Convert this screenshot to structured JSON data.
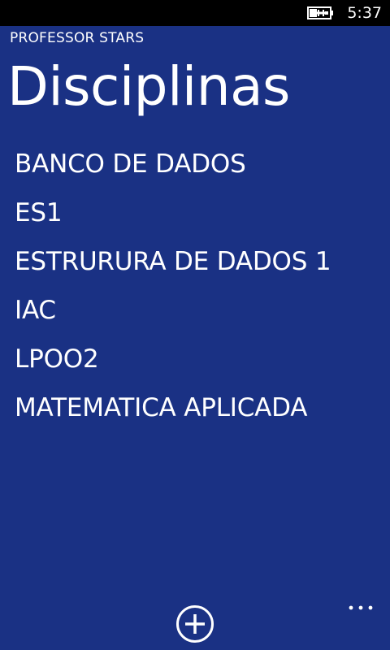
{
  "status_bar": {
    "time": "5:37",
    "battery_icon": "battery-charging-icon"
  },
  "header": {
    "app_title": "PROFESSOR STARS",
    "page_title": "Disciplinas"
  },
  "subjects": [
    {
      "label": "BANCO DE DADOS"
    },
    {
      "label": "ES1"
    },
    {
      "label": "ESTRURURA DE DADOS 1"
    },
    {
      "label": "IAC"
    },
    {
      "label": "LPOO2"
    },
    {
      "label": "MATEMATICA APLICADA"
    }
  ],
  "app_bar": {
    "add_icon": "plus-circle-icon",
    "more_icon": "ellipsis-icon"
  },
  "colors": {
    "background": "#1a3184",
    "status_bar": "#000000",
    "foreground": "#ffffff"
  }
}
